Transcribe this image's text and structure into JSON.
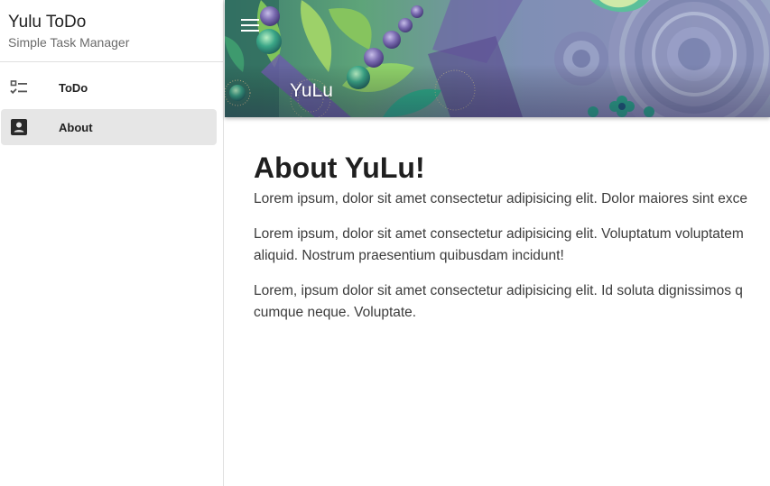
{
  "drawer": {
    "title": "Yulu ToDo",
    "subtitle": "Simple Task Manager",
    "items": [
      {
        "label": "ToDo",
        "icon": "checklist-icon",
        "active": false
      },
      {
        "label": "About",
        "icon": "contact-card-icon",
        "active": true
      }
    ]
  },
  "header": {
    "title": "YuLu",
    "menu_icon": "hamburger-menu-icon"
  },
  "main": {
    "heading": "About YuLu!",
    "paragraphs": [
      {
        "line1": "Lorem ipsum, dolor sit amet consectetur adipisicing elit. Dolor maiores sint exce"
      },
      {
        "line1": "Lorem ipsum, dolor sit amet consectetur adipisicing elit. Voluptatum voluptatem",
        "line2": "aliquid. Nostrum praesentium quibusdam incidunt!"
      },
      {
        "line1": "Lorem, ipsum dolor sit amet consectetur adipisicing elit. Id soluta dignissimos q",
        "line2": "cumque neque. Voluptate."
      }
    ]
  },
  "colors": {
    "active_item_bg": "#e6e6e6",
    "header_teal": "#3fa58a",
    "header_purple": "#6a5f9e"
  }
}
